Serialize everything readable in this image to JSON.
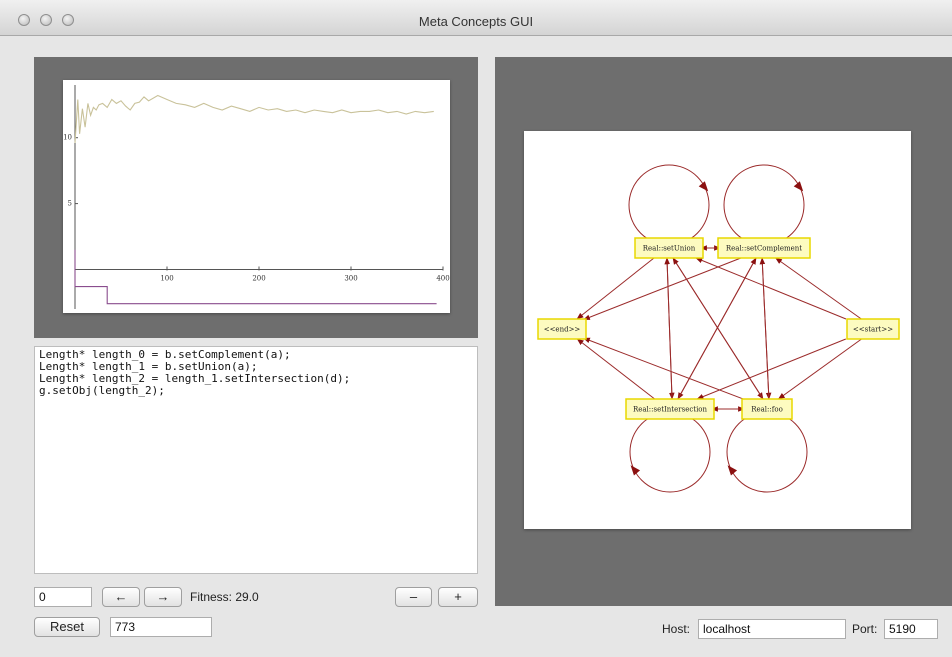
{
  "window": {
    "title": "Meta Concepts GUI"
  },
  "chart_data": {
    "type": "line",
    "x_ticks": [
      "100",
      "200",
      "300",
      "400"
    ],
    "y_ticks": [
      "5",
      "10"
    ],
    "xlim": [
      0,
      400
    ],
    "ylim": [
      -3,
      14
    ],
    "series": [
      {
        "color": "#c9c29a",
        "x": [
          0,
          3,
          5,
          8,
          11,
          14,
          17,
          20,
          23,
          26,
          30,
          35,
          40,
          45,
          50,
          55,
          60,
          65,
          70,
          75,
          80,
          90,
          100,
          110,
          120,
          130,
          140,
          150,
          160,
          170,
          180,
          190,
          200,
          210,
          220,
          230,
          240,
          250,
          260,
          270,
          280,
          290,
          300,
          310,
          320,
          330,
          340,
          350,
          360,
          370,
          380,
          390
        ],
        "y": [
          9.6,
          12.9,
          10.3,
          12.2,
          10.8,
          12.6,
          11.7,
          12.3,
          12.1,
          12.5,
          12.6,
          12.3,
          12.9,
          12.6,
          12.8,
          12.4,
          12.1,
          12.6,
          12.7,
          13.1,
          12.8,
          13.2,
          12.9,
          12.6,
          12.5,
          12.3,
          12.6,
          12.3,
          12.1,
          12.4,
          12.2,
          12.0,
          12.3,
          12.1,
          12.2,
          12.0,
          12.1,
          11.9,
          12.1,
          12.0,
          11.9,
          12.1,
          11.9,
          12.0,
          12.0,
          12.1,
          11.9,
          12.0,
          11.8,
          12.0,
          11.9,
          12.0
        ]
      },
      {
        "color": "#8a4d8e",
        "x": [
          0,
          0,
          3,
          3,
          35,
          35,
          393
        ],
        "y": [
          1.5,
          -1.3,
          -1.3,
          -1.3,
          -1.3,
          -2.6,
          -2.6
        ]
      }
    ]
  },
  "code_lines": [
    "Length* length_0 = b.setComplement(a);",
    "Length* length_1 = b.setUnion(a);",
    "Length* length_2 = length_1.setIntersection(d);",
    "g.setObj(length_2);"
  ],
  "controls": {
    "index_value": "0",
    "prev_label": "←",
    "next_label": "→",
    "fitness_text": "Fitness: 29.0",
    "minus_label": "–",
    "plus_label": "+",
    "reset_label": "Reset",
    "seed_value": "773",
    "host_label": "Host:",
    "host_value": "localhost",
    "port_label": "Port:",
    "port_value": "5190"
  },
  "graph": {
    "edge_color": "#9b2b2b",
    "node_fill": "#fdfbc0",
    "node_stroke": "#e8d800",
    "nodes": [
      {
        "id": "union",
        "label": "Real::setUnion"
      },
      {
        "id": "complement",
        "label": "Real::setComplement"
      },
      {
        "id": "end",
        "label": "<<end>>"
      },
      {
        "id": "start",
        "label": "<<start>>"
      },
      {
        "id": "intersection",
        "label": "Real::setIntersection"
      },
      {
        "id": "foo",
        "label": "Real::foo"
      }
    ]
  }
}
